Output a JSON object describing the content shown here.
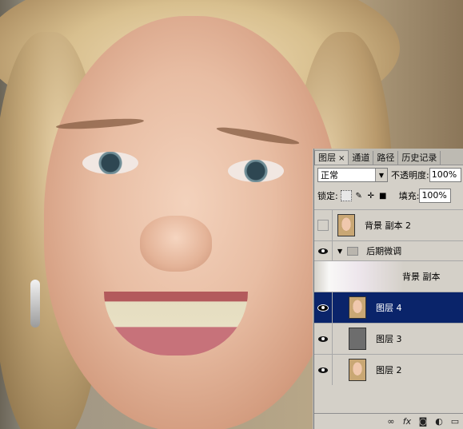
{
  "panel": {
    "tabs": [
      {
        "label": "图层",
        "close": "×",
        "active": true
      },
      {
        "label": "通道"
      },
      {
        "label": "路径"
      },
      {
        "label": "历史记录"
      }
    ],
    "blend_mode": "正常",
    "opacity_label": "不透明度:",
    "opacity_value": "100%",
    "lock_label": "锁定:",
    "fill_label": "填充:",
    "fill_value": "100%",
    "layers": [
      {
        "name": "背景 副本 2",
        "visible": false,
        "selected": false
      },
      {
        "name": "后期微调",
        "visible": true,
        "type": "group"
      },
      {
        "name": "背景 副本",
        "visible": true,
        "in_group": true
      },
      {
        "name": "图层 4",
        "visible": true,
        "selected": true
      },
      {
        "name": "图层 3",
        "visible": true
      },
      {
        "name": "图层 2",
        "visible": true
      }
    ],
    "toolbar_icons": [
      "link-icon",
      "fx-icon",
      "mask-icon",
      "adjustment-icon",
      "new-layer-icon"
    ],
    "selection_color": "#0a246a"
  }
}
